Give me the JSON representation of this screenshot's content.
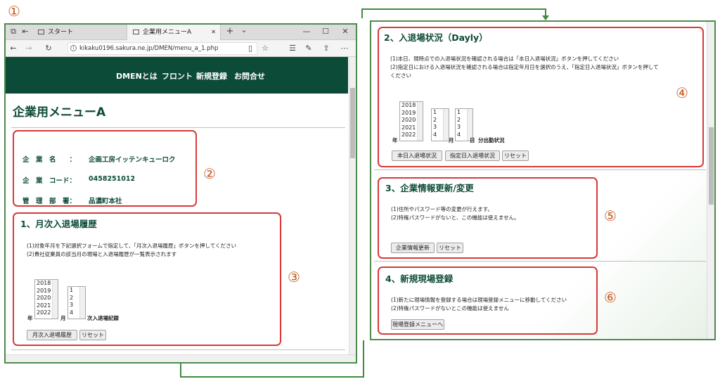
{
  "markers": {
    "m1": "①",
    "m2": "②",
    "m3": "③",
    "m4": "④",
    "m5": "⑤",
    "m6": "⑥"
  },
  "browser": {
    "tab1_label": "スタート",
    "tab2_label": "企業用メニューA",
    "tab_close": "✕",
    "new_tab": "+",
    "tab_list": "⌄",
    "win_min": "—",
    "win_max": "☐",
    "win_close": "✕",
    "url": "kikaku0196.sakura.ne.jp/DMEN/menu_a_1.php"
  },
  "site_nav": {
    "items": [
      "DMENとは",
      "フロント",
      "新規登録",
      "お問合せ"
    ]
  },
  "page_title": "企業用メニューA",
  "company": {
    "name_label": "企　業　名　　：",
    "name_value": "企画工房イッテンキューロク",
    "code_label": "企　業　コード：",
    "code_value": "0458251012",
    "dept_label": "管　理　部　署：",
    "dept_value": "品濃町本社"
  },
  "section1": {
    "title": "1、月次入退場履歴",
    "line1": "(1)対象年月を下記選択フォームで指定して、「月次入退場履歴」ボタンを押してください",
    "line2": "(2)貴社従業員の該当月の現場と入退場履歴が一覧表示されます",
    "years": [
      "2018",
      "2019",
      "2020",
      "2021",
      "2022"
    ],
    "months": [
      "1",
      "2",
      "3",
      "4"
    ],
    "year_label": "年",
    "month_label": "月",
    "suffix_label": "次入退場記録",
    "btn_history": "月次入退場履歴",
    "btn_reset": "リセット"
  },
  "section2": {
    "title": "2、入退場状況（Dayly）",
    "line1": "(1)本日、現時点での入退場状況を確認される場合は「本日入退場状況」ボタンを押してください",
    "line2a": "(2)指定日における入退場状況を確認される場合は指定年月日を選択のうえ、「指定日入退場状況」ボタンを押して",
    "line2b": "ください",
    "years": [
      "2018",
      "2019",
      "2020",
      "2021",
      "2022"
    ],
    "months": [
      "1",
      "2",
      "3",
      "4"
    ],
    "days": [
      "1",
      "2",
      "3",
      "4"
    ],
    "year_label": "年",
    "month_label": "月",
    "day_label": "日",
    "suffix_label": "分出勤状況",
    "btn_today": "本日入退場状況",
    "btn_date": "指定日入退場状況",
    "btn_reset": "リセット"
  },
  "section3": {
    "title": "3、企業情報更新/変更",
    "line1": "(1)住所やパスワード等の変更が行えます。",
    "line2": "(2)特権パスワードがないと、この機能は使えません。",
    "btn_update": "企業情報更新",
    "btn_reset": "リセット"
  },
  "section4": {
    "title": "4、新規現場登録",
    "line1": "(1)新たに現場情報を登録する場合は現場登録メニューに移動してください",
    "line2": "(2)特権パスワードがないとこの機能は使えません",
    "btn_menu": "現場登録メニューへ"
  },
  "colors": {
    "brand_green": "#0c4b37",
    "highlight_red": "#d63a3a",
    "marker_orange": "#c8581c",
    "frame_green": "#4f8a4f"
  }
}
